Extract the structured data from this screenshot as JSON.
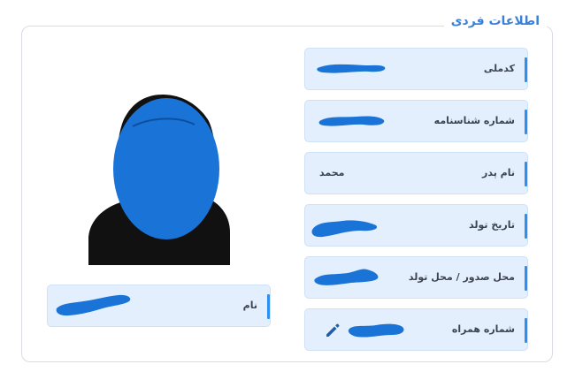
{
  "section": {
    "title": "اطلاعات فردی"
  },
  "fields": [
    {
      "label": "کدملی",
      "value": ""
    },
    {
      "label": "شماره شناسنامه",
      "value": ""
    },
    {
      "label": "نام پدر",
      "value": "محمد"
    },
    {
      "label": "تاریخ تولد",
      "value": ""
    },
    {
      "label": "محل صدور / محل تولد",
      "value": ""
    },
    {
      "label": "شماره همراه",
      "value": ""
    }
  ],
  "name_field": {
    "label": "نام",
    "value": ""
  },
  "icons": {
    "edit": "pencil-icon"
  },
  "colors": {
    "accent": "#2d8ff0",
    "field_bg": "#e3effc",
    "redaction": "#1a73d6",
    "title": "#3b7fd6"
  }
}
